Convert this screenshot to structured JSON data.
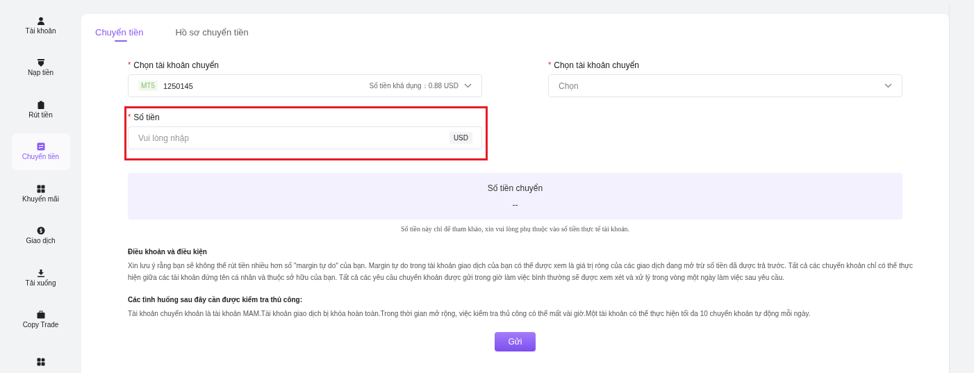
{
  "sidebar": {
    "items": [
      {
        "label": "Tài khoản",
        "selected": false
      },
      {
        "label": "Nạp tiền",
        "selected": false
      },
      {
        "label": "Rút tiền",
        "selected": false
      },
      {
        "label": "Chuyển tiền",
        "selected": true
      },
      {
        "label": "Khuyến mãi",
        "selected": false
      },
      {
        "label": "Giao dịch",
        "selected": false
      },
      {
        "label": "Tải xuống",
        "selected": false
      },
      {
        "label": "Copy Trade",
        "selected": false
      },
      {
        "selected": false
      }
    ]
  },
  "tabs": [
    {
      "label": "Chuyển tiền",
      "selected": true
    },
    {
      "label": "Hồ sơ chuyển tiền",
      "selected": false
    }
  ],
  "form": {
    "source": {
      "mark": "*",
      "label": "Chọn tài khoản chuyển",
      "platform": "MT5",
      "account": "1250145",
      "balance": "Số tiền khả dụng：0.88 USD"
    },
    "target": {
      "mark": "*",
      "label": "Chọn tài khoản chuyển",
      "placeholder": "Chọn"
    },
    "amount": {
      "mark": "*",
      "label": "Số tiền",
      "placeholder": "Vui lòng nhập",
      "unit": "USD"
    }
  },
  "summary": {
    "title": "Số tiền chuyển",
    "value": "--"
  },
  "note": "Số tiền này chỉ để tham khảo, xin vui lòng phụ thuộc vào số tiền thực tế tài khoản.",
  "terms": [
    {
      "title": "Điều khoản và điều kiện",
      "text": "Xin lưu ý rằng bạn sẽ không thể rút tiền nhiều hơn số \"margin tự do\" của bạn. Margin tự do trong tài khoản giao dịch của bạn có thể được xem là giá trị ròng của các giao dịch đang mở trừ số tiền đã được trả trước. Tất cả các chuyển khoản chỉ có thể thực hiện giữa các tài khoản đứng tên cá nhân và thuộc sở hữu của bạn. Tất cả các yêu cầu chuyển khoản được gửi trong giờ làm việc bình thường sẽ được xem xét và xử lý trong vòng một ngày làm việc sau yêu cầu."
    },
    {
      "title": "Các tình huống sau đây cần được kiểm tra thủ công:",
      "text": "Tài khoản chuyển khoản là tài khoản MAM.Tài khoản giao dịch bị khóa hoàn toàn.Trong thời gian mở rộng, việc kiểm tra thủ công có thể mất vài giờ.Một tài khoản có thể thực hiện tối đa 10 chuyển khoản tự động mỗi ngày."
    }
  ],
  "submit": "Gửi"
}
